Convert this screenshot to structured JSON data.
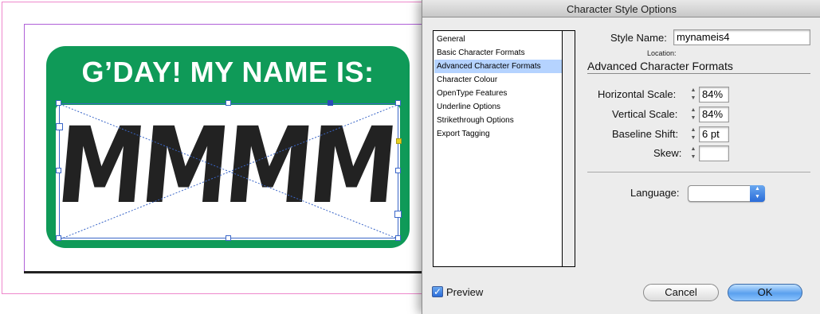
{
  "canvas": {
    "badge_header": "G’DAY! MY NAME IS:",
    "name_text": "MMMM",
    "badge_color": "#0f9a58"
  },
  "dialog": {
    "title": "Character Style Options",
    "sections": [
      {
        "label": "General",
        "selected": false
      },
      {
        "label": "Basic Character Formats",
        "selected": false
      },
      {
        "label": "Advanced Character Formats",
        "selected": true
      },
      {
        "label": "Character Colour",
        "selected": false
      },
      {
        "label": "OpenType Features",
        "selected": false
      },
      {
        "label": "Underline Options",
        "selected": false
      },
      {
        "label": "Strikethrough Options",
        "selected": false
      },
      {
        "label": "Export Tagging",
        "selected": false
      }
    ],
    "style_name_label": "Style Name:",
    "style_name_value": "mynameis4",
    "location_label": "Location:",
    "section_heading": "Advanced Character Formats",
    "fields": {
      "horizontal_scale": {
        "label": "Horizontal Scale:",
        "value": "84%"
      },
      "vertical_scale": {
        "label": "Vertical Scale:",
        "value": "84%"
      },
      "baseline_shift": {
        "label": "Baseline Shift:",
        "value": "6 pt"
      },
      "skew": {
        "label": "Skew:",
        "value": ""
      }
    },
    "language_label": "Language:",
    "language_value": "",
    "preview_label": "Preview",
    "preview_checked": true,
    "cancel_label": "Cancel",
    "ok_label": "OK"
  },
  "icons": [
    "checkbox-checked-icon",
    "stepper-arrows-icon",
    "dropdown-arrows-icon"
  ]
}
